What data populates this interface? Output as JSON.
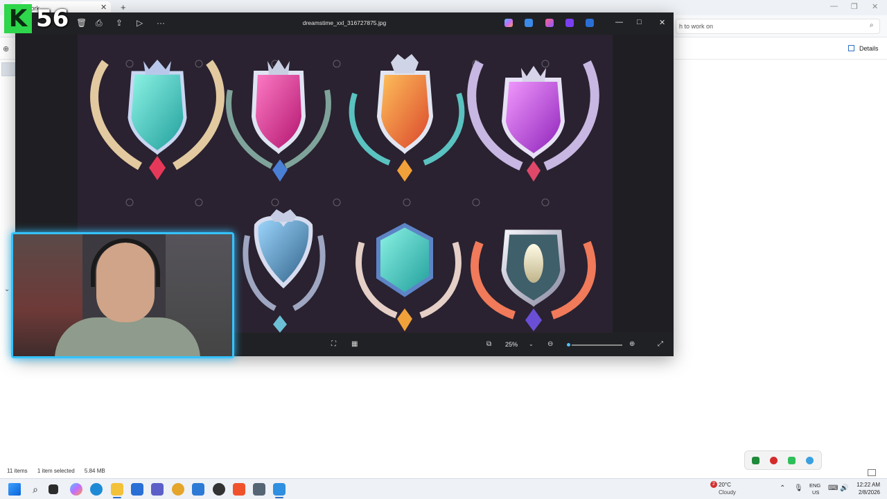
{
  "explorer": {
    "tab_title": "work",
    "search_placeholder": "h to work on",
    "details_label": "Details",
    "status": {
      "items": "11 items",
      "selected": "1 item selected",
      "size": "5.84 MB"
    }
  },
  "viewer": {
    "title": "dreamstime_xxl_316727875.jpg",
    "zoom": "25%",
    "zoom_slider_value": 0.03,
    "toolbar_icons": [
      "delete-icon",
      "print-icon",
      "share-icon",
      "slideshow-icon",
      "more-icon"
    ],
    "app_icons": [
      "copilot-icon",
      "edit-icon",
      "paint-icon",
      "clipchamp-icon",
      "onedrive-icon"
    ]
  },
  "overlay": {
    "counter": "56",
    "counter_letter": "K"
  },
  "taskbar": {
    "weather_temp": "20°C",
    "weather_cond": "Cloudy",
    "weather_badge": "2",
    "lang_line1": "ENG",
    "lang_line2": "US",
    "time": "12:22 AM",
    "date": "2/8/2026"
  },
  "colors": {
    "accent": "#2b6fc4",
    "webcam_border": "#35c3ff",
    "counter_green": "#2dd64a",
    "viewer_bg": "#1f1f23",
    "canvas_bg": "#2a2230"
  }
}
